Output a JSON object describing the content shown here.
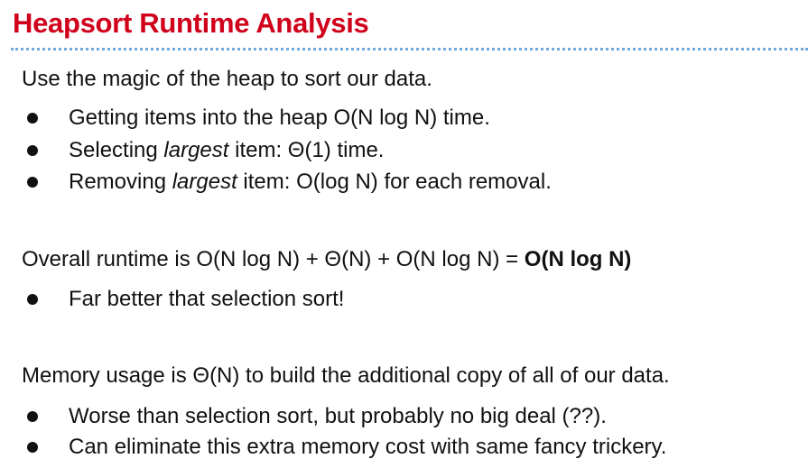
{
  "slide": {
    "title": "Heapsort Runtime Analysis",
    "intro": "Use the magic of the heap to sort our data.",
    "intro_bullets": [
      {
        "pre": "Getting items into the heap O(N log N) time.",
        "em": "",
        "post": ""
      },
      {
        "pre": "Selecting ",
        "em": "largest",
        "post": " item: Θ(1) time."
      },
      {
        "pre": "Removing ",
        "em": "largest",
        "post": " item: O(log N) for each removal."
      }
    ],
    "overall_prefix": "Overall runtime is O(N log N) + Θ(N) + O(N log N) = ",
    "overall_result": "O(N log N)",
    "overall_bullets": [
      "Far better that selection sort!"
    ],
    "memory": "Memory usage is Θ(N) to build the additional copy of all of our data.",
    "memory_bullets": [
      "Worse than selection sort, but probably no big deal (??).",
      "Can eliminate this extra memory cost with same fancy trickery."
    ]
  },
  "colors": {
    "title": "#d0021b",
    "rule": "#6fa8dc",
    "text": "#111111"
  }
}
